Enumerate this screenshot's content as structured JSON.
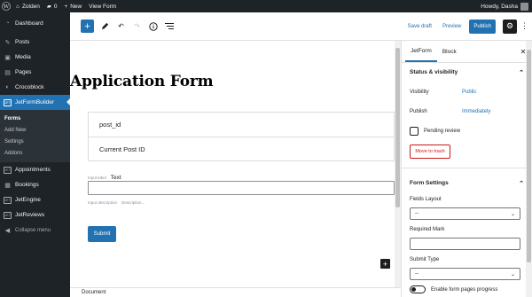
{
  "admin_bar": {
    "site_name": "Zolden",
    "comments_count": "0",
    "new_label": "New",
    "view_label": "View Form",
    "greeting": "Howdy, Dasha"
  },
  "sidebar": {
    "items_top": [
      {
        "label": "Dashboard",
        "icon": "dashboard-icon"
      }
    ],
    "items_content": [
      {
        "label": "Posts",
        "icon": "pin-icon"
      },
      {
        "label": "Media",
        "icon": "media-icon"
      },
      {
        "label": "Pages",
        "icon": "page-icon"
      },
      {
        "label": "Crocoblock",
        "icon": "crocoblock-icon"
      }
    ],
    "current_item": {
      "label": "JetFormBuilder",
      "icon": "jet-icon"
    },
    "submenu": [
      "Forms",
      "Add New",
      "Settings",
      "Addons"
    ],
    "items_bottom": [
      {
        "label": "Appointments",
        "icon": "jet-icon"
      },
      {
        "label": "Bookings",
        "icon": "bookings-icon"
      },
      {
        "label": "JetEngine",
        "icon": "jet-icon"
      },
      {
        "label": "JetReviews",
        "icon": "jet-icon"
      }
    ],
    "collapse_label": "Collapse menu"
  },
  "toolbar": {
    "save_draft": "Save draft",
    "preview": "Preview",
    "publish": "Publish"
  },
  "editor": {
    "title": "Application Form",
    "hidden_fields": [
      "post_id",
      "Current Post ID"
    ],
    "input_label_hint": "Input label",
    "input_label_value": "Text",
    "input_desc_hint": "Input description",
    "input_desc_value": "Description...",
    "submit_label": "Submit",
    "footer_breadcrumb": "Document"
  },
  "panel": {
    "tabs": [
      "JetForm",
      "Block"
    ],
    "status_section": "Status & visibility",
    "visibility_label": "Visibility",
    "visibility_value": "Public",
    "publish_label": "Publish",
    "publish_value": "Immediately",
    "pending_review": "Pending review",
    "move_to_trash": "Move to trash",
    "form_settings": "Form Settings",
    "fields_layout_label": "Fields Layout",
    "fields_layout_value": "--",
    "required_mark_label": "Required Mark",
    "submit_type_label": "Submit Type",
    "submit_type_value": "--",
    "enable_pages_label": "Enable form pages progress"
  },
  "colors": {
    "admin_dark": "#1d2327",
    "accent": "#2271b1",
    "danger": "#cc1818"
  }
}
